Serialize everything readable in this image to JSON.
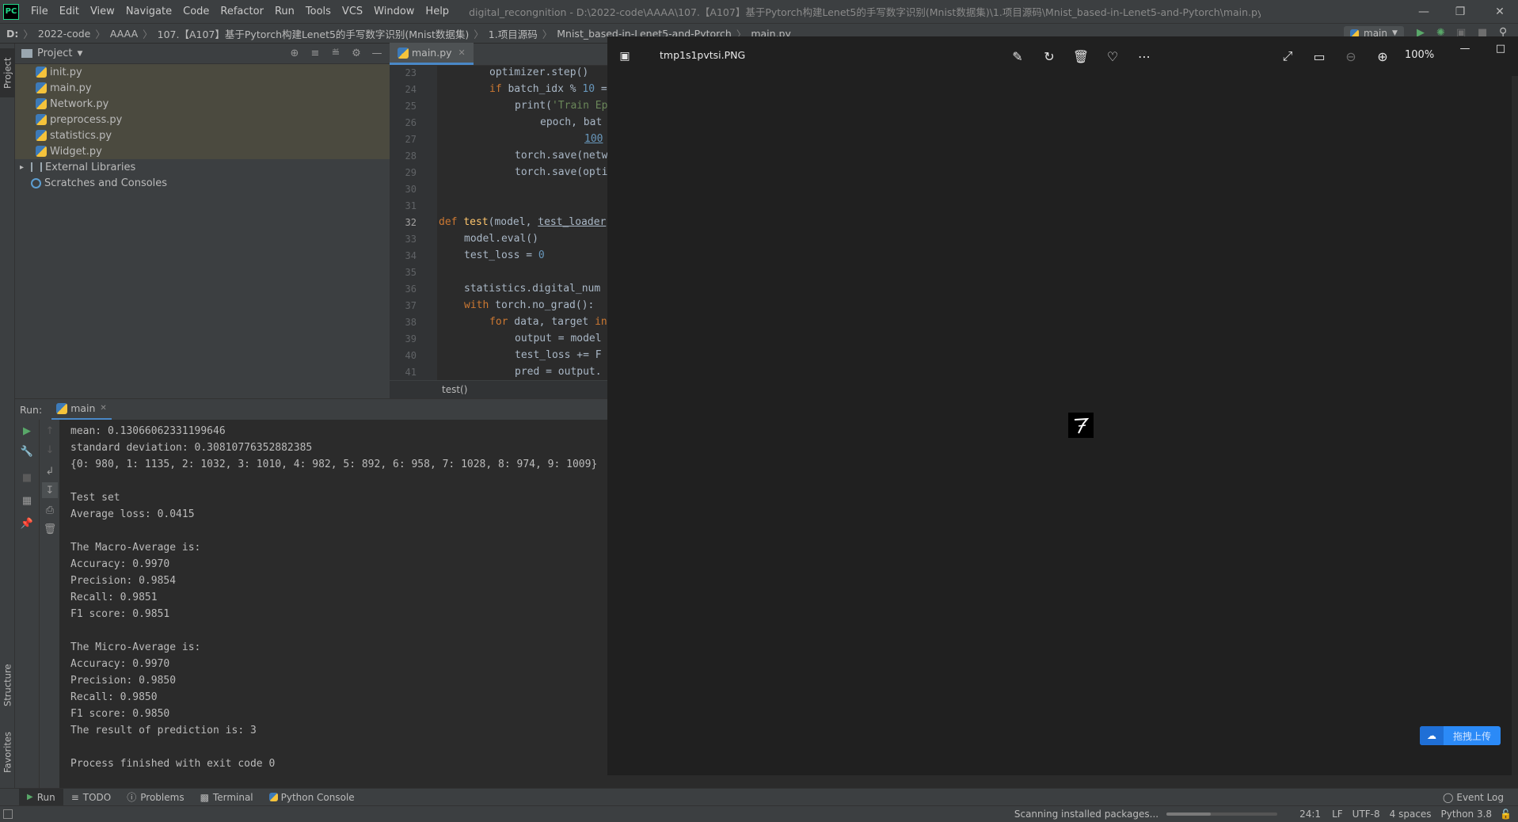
{
  "titlebar": {
    "menu": [
      "File",
      "Edit",
      "View",
      "Navigate",
      "Code",
      "Refactor",
      "Run",
      "Tools",
      "VCS",
      "Window",
      "Help"
    ],
    "window_title": "digital_recongnition - D:\\2022-code\\AAAA\\107.【A107】基于Pytorch构建Lenet5的手写数字识别(Mnist数据集)\\1.项目源码\\Mnist_based-in-Lenet5-and-Pytorch\\main.py"
  },
  "breadcrumb": [
    "D:",
    "2022-code",
    "AAAA",
    "107.【A107】基于Pytorch构建Lenet5的手写数字识别(Mnist数据集)",
    "1.项目源码",
    "Mnist_based-in-Lenet5-and-Pytorch",
    "main.py"
  ],
  "left_strip": {
    "project": "Project",
    "structure": "Structure",
    "favorites": "Favorites"
  },
  "project": {
    "title": "Project",
    "files": [
      "init.py",
      "main.py",
      "Network.py",
      "preprocess.py",
      "statistics.py",
      "Widget.py"
    ],
    "external": "External Libraries",
    "scratches": "Scratches and Consoles"
  },
  "editor": {
    "tab": "main.py",
    "current_line": 32,
    "line_numbers": [
      23,
      24,
      25,
      26,
      27,
      28,
      29,
      30,
      31,
      32,
      33,
      34,
      35,
      36,
      37,
      38,
      39,
      40,
      41
    ],
    "footer": "test()"
  },
  "run": {
    "label": "Run:",
    "tab": "main",
    "console": [
      "mean: 0.13066062331199646",
      "standard deviation: 0.30810776352882385",
      "{0: 980, 1: 1135, 2: 1032, 3: 1010, 4: 982, 5: 892, 6: 958, 7: 1028, 8: 974, 9: 1009}",
      "",
      "Test set",
      "Average loss: 0.0415",
      "",
      "The Macro-Average is:",
      "Accuracy: 0.9970",
      "Precision: 0.9854",
      "Recall: 0.9851",
      "F1 score: 0.9851",
      "",
      "The Micro-Average is:",
      "Accuracy: 0.9970",
      "Precision: 0.9850",
      "Recall: 0.9850",
      "F1 score: 0.9850",
      "The result of prediction is: 3",
      "",
      "Process finished with exit code 0"
    ]
  },
  "bottom_tabs": [
    "Run",
    "TODO",
    "Problems",
    "Terminal",
    "Python Console"
  ],
  "event_log": "Event Log",
  "status": {
    "task": "Scanning installed packages...",
    "position": "24:1",
    "line_sep": "LF",
    "encoding": "UTF-8",
    "indent": "4 spaces",
    "interpreter": "Python 3.8"
  },
  "run_config": "main",
  "viewer": {
    "filename": "tmp1s1pvtsi.PNG",
    "zoom": "100%",
    "upload_label": "拖拽上传",
    "image_digit": "7"
  },
  "colors": {
    "accent": "#4a88c7",
    "upload": "#2b8af7"
  }
}
